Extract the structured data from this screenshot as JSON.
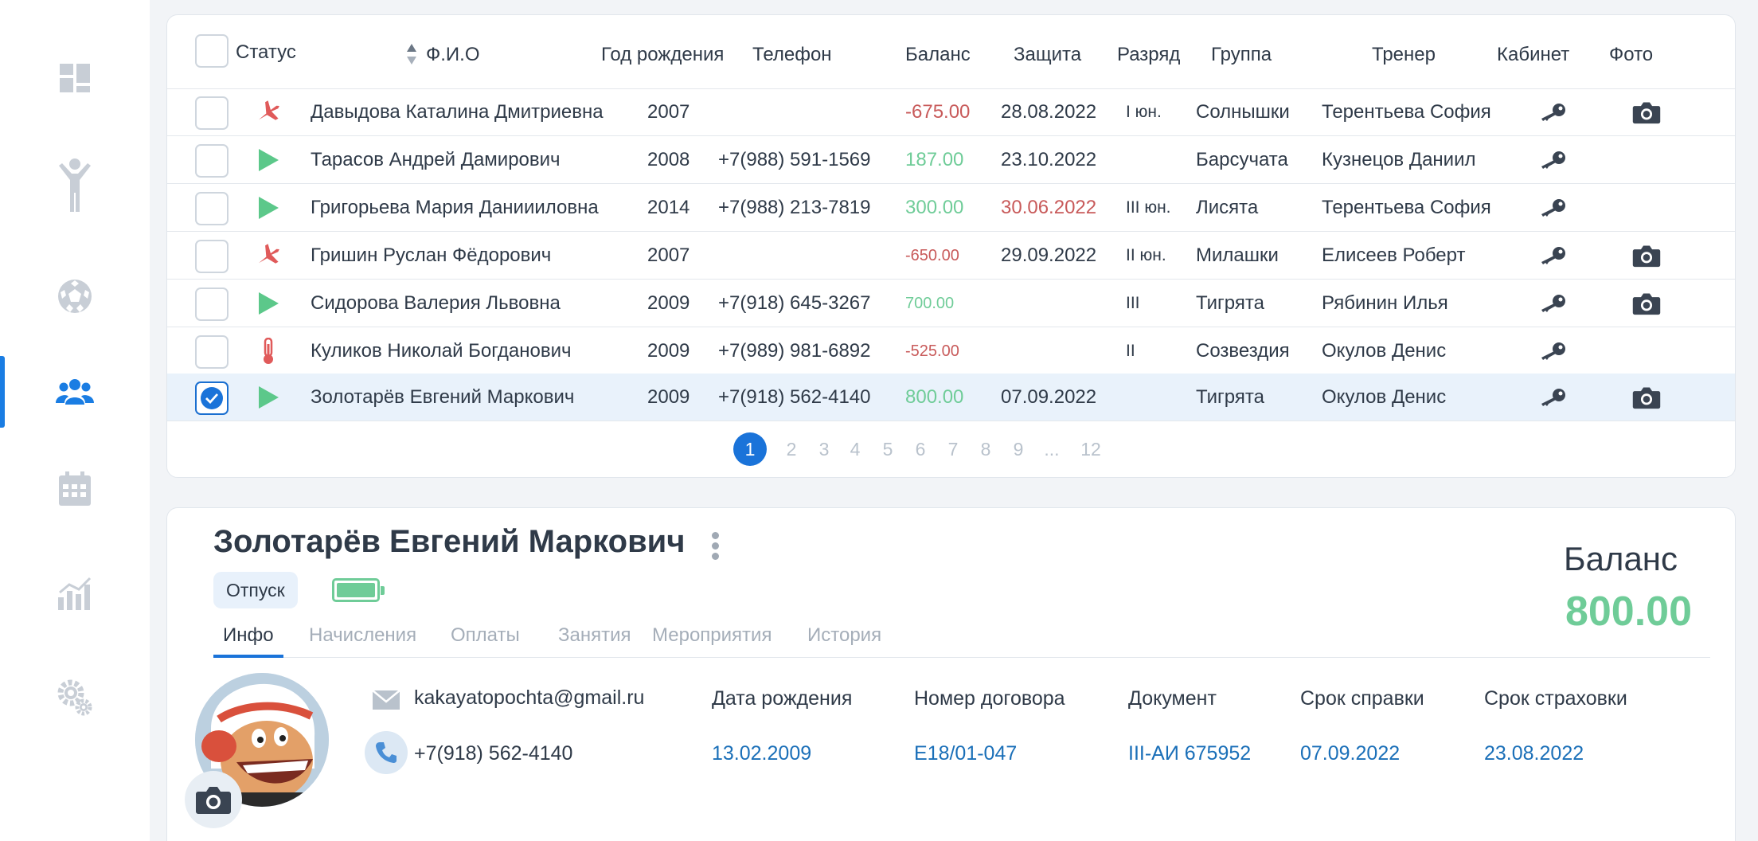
{
  "sidebar": {
    "items": [
      {
        "icon": "dashboard-icon"
      },
      {
        "icon": "athlete-icon"
      },
      {
        "icon": "soccer-ball-icon"
      },
      {
        "icon": "users-group-icon",
        "active": true
      },
      {
        "icon": "calendar-icon"
      },
      {
        "icon": "chart-icon"
      },
      {
        "icon": "settings-icon"
      }
    ]
  },
  "table": {
    "headers": {
      "status": "Статус",
      "fio": "Ф.И.О",
      "birth_year": "Год рождения",
      "phone": "Телефон",
      "balance": "Баланс",
      "protection": "Защита",
      "rank": "Разряд",
      "group": "Группа",
      "trainer": "Тренер",
      "cabinet": "Кабинет",
      "photo": "Фото"
    },
    "rows": [
      {
        "status": "plane",
        "name": "Давыдова Каталина Дмитриевна",
        "year": "2007",
        "phone": "",
        "balance": "-675.00",
        "balance_type": "neg",
        "protection": "28.08.2022",
        "protection_expired": false,
        "rank": "I юн.",
        "group": "Солнышки",
        "trainer": "Терентьева София",
        "photo": true,
        "selected": false
      },
      {
        "status": "play",
        "name": "Тарасов Андрей Дамирович",
        "year": "2008",
        "phone": "+7(988) 591-1569",
        "balance": "187.00",
        "balance_type": "pos",
        "protection": "23.10.2022",
        "protection_expired": false,
        "rank": "",
        "group": "Барсучата",
        "trainer": "Кузнецов Даниил",
        "photo": false,
        "selected": false
      },
      {
        "status": "play",
        "name": "Григорьева Мария Даниииловна",
        "year": "2014",
        "phone": "+7(988) 213-7819",
        "balance": "300.00",
        "balance_type": "pos",
        "protection": "30.06.2022",
        "protection_expired": true,
        "rank": "III юн.",
        "group": "Лисята",
        "trainer": "Терентьева София",
        "photo": false,
        "selected": false
      },
      {
        "status": "plane",
        "name": "Гришин Руслан Фёдорович",
        "year": "2007",
        "phone": "",
        "balance": "-650.00",
        "balance_type": "neg-small",
        "protection": "29.09.2022",
        "protection_expired": false,
        "rank": "II юн.",
        "group": "Милашки",
        "trainer": "Елисеев Роберт",
        "photo": true,
        "selected": false
      },
      {
        "status": "play",
        "name": "Сидорова Валерия Львовна",
        "year": "2009",
        "phone": "+7(918) 645-3267",
        "balance": "700.00",
        "balance_type": "pos-small",
        "protection": "",
        "protection_expired": false,
        "rank": "III",
        "group": "Тигрята",
        "trainer": "Рябинин Илья",
        "photo": true,
        "selected": false
      },
      {
        "status": "thermometer",
        "name": "Куликов Николай Богданович",
        "year": "2009",
        "phone": "+7(989) 981-6892",
        "balance": "-525.00",
        "balance_type": "neg-small",
        "protection": "",
        "protection_expired": false,
        "rank": "II",
        "group": "Созвездия",
        "trainer": "Окулов Денис",
        "photo": false,
        "selected": false
      },
      {
        "status": "play",
        "name": "Золотарёв Евгений Маркович",
        "year": "2009",
        "phone": "+7(918) 562-4140",
        "balance": "800.00",
        "balance_type": "pos",
        "protection": "07.09.2022",
        "protection_expired": false,
        "rank": "",
        "group": "Тигрята",
        "trainer": "Окулов Денис",
        "photo": true,
        "selected": true
      }
    ],
    "pagination": [
      "1",
      "2",
      "3",
      "4",
      "5",
      "6",
      "7",
      "8",
      "9",
      "...",
      "12"
    ],
    "current_page": "1"
  },
  "detail": {
    "name": "Золотарёв Евгений Маркович",
    "status_chip": "Отпуск",
    "balance_label": "Баланс",
    "balance_value": "800.00",
    "tabs": [
      "Инфо",
      "Начисления",
      "Оплаты",
      "Занятия",
      "Мероприятия",
      "История"
    ],
    "active_tab": "Инфо",
    "email": "kakayatopochta@gmail.ru",
    "phone": "+7(918) 562-4140",
    "info": [
      {
        "label": "Дата рождения",
        "value": "13.02.2009"
      },
      {
        "label": "Номер договора",
        "value": "Е18/01-047"
      },
      {
        "label": "Документ",
        "value": "III-АИ 675952"
      },
      {
        "label": "Срок справки",
        "value": "07.09.2022"
      },
      {
        "label": "Срок страховки",
        "value": "23.08.2022"
      }
    ]
  },
  "colors": {
    "accent": "#1a73d9",
    "positive": "#6fcc98",
    "negative": "#c85a5a",
    "status_plane": "#e05a5a",
    "status_play": "#5cc88a"
  }
}
